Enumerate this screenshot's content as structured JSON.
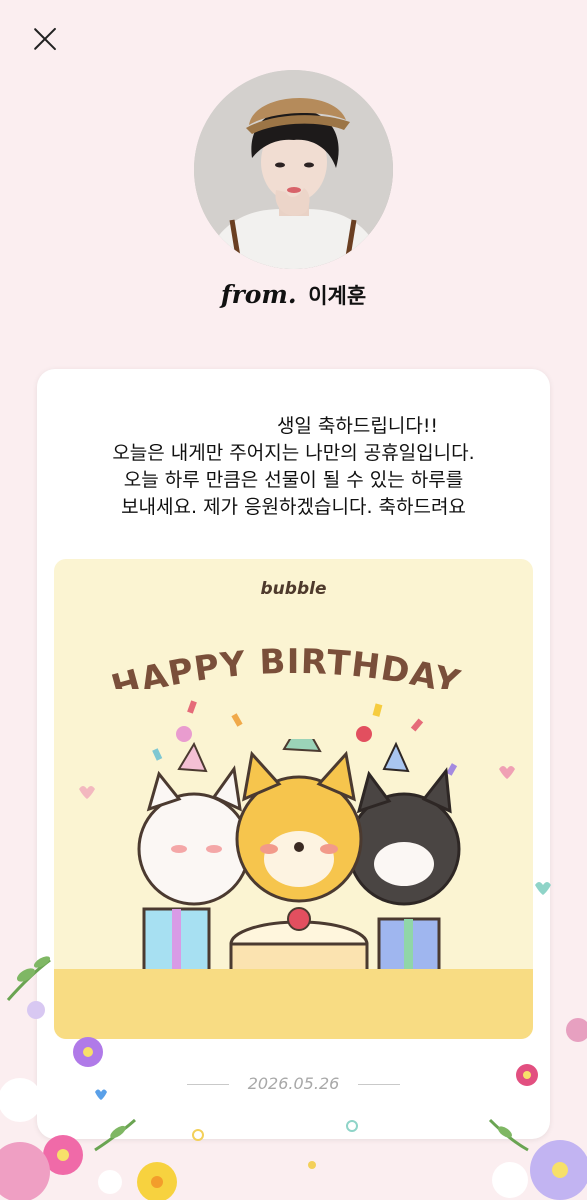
{
  "header": {
    "close_icon": "close-icon"
  },
  "sender": {
    "from_label": "from.",
    "name": "이계훈"
  },
  "letter": {
    "lines": [
      "생일 축하드립니다!!",
      "오늘은 내게만 주어지는 나만의 공휴일입니다.",
      "오늘 하루 만큼은 선물이 될 수 있는 하루를",
      "보내세요. 제가 응원하겠습니다. 축하드려요"
    ]
  },
  "card_image": {
    "brand": "bubble",
    "headline": "HAPPY BIRTHDAY!"
  },
  "date": "2026.05.26",
  "colors": {
    "background": "#fbeef0",
    "card": "#ffffff",
    "birthday_bg": "#fbf4d2",
    "headline": "#7a4f3a"
  }
}
